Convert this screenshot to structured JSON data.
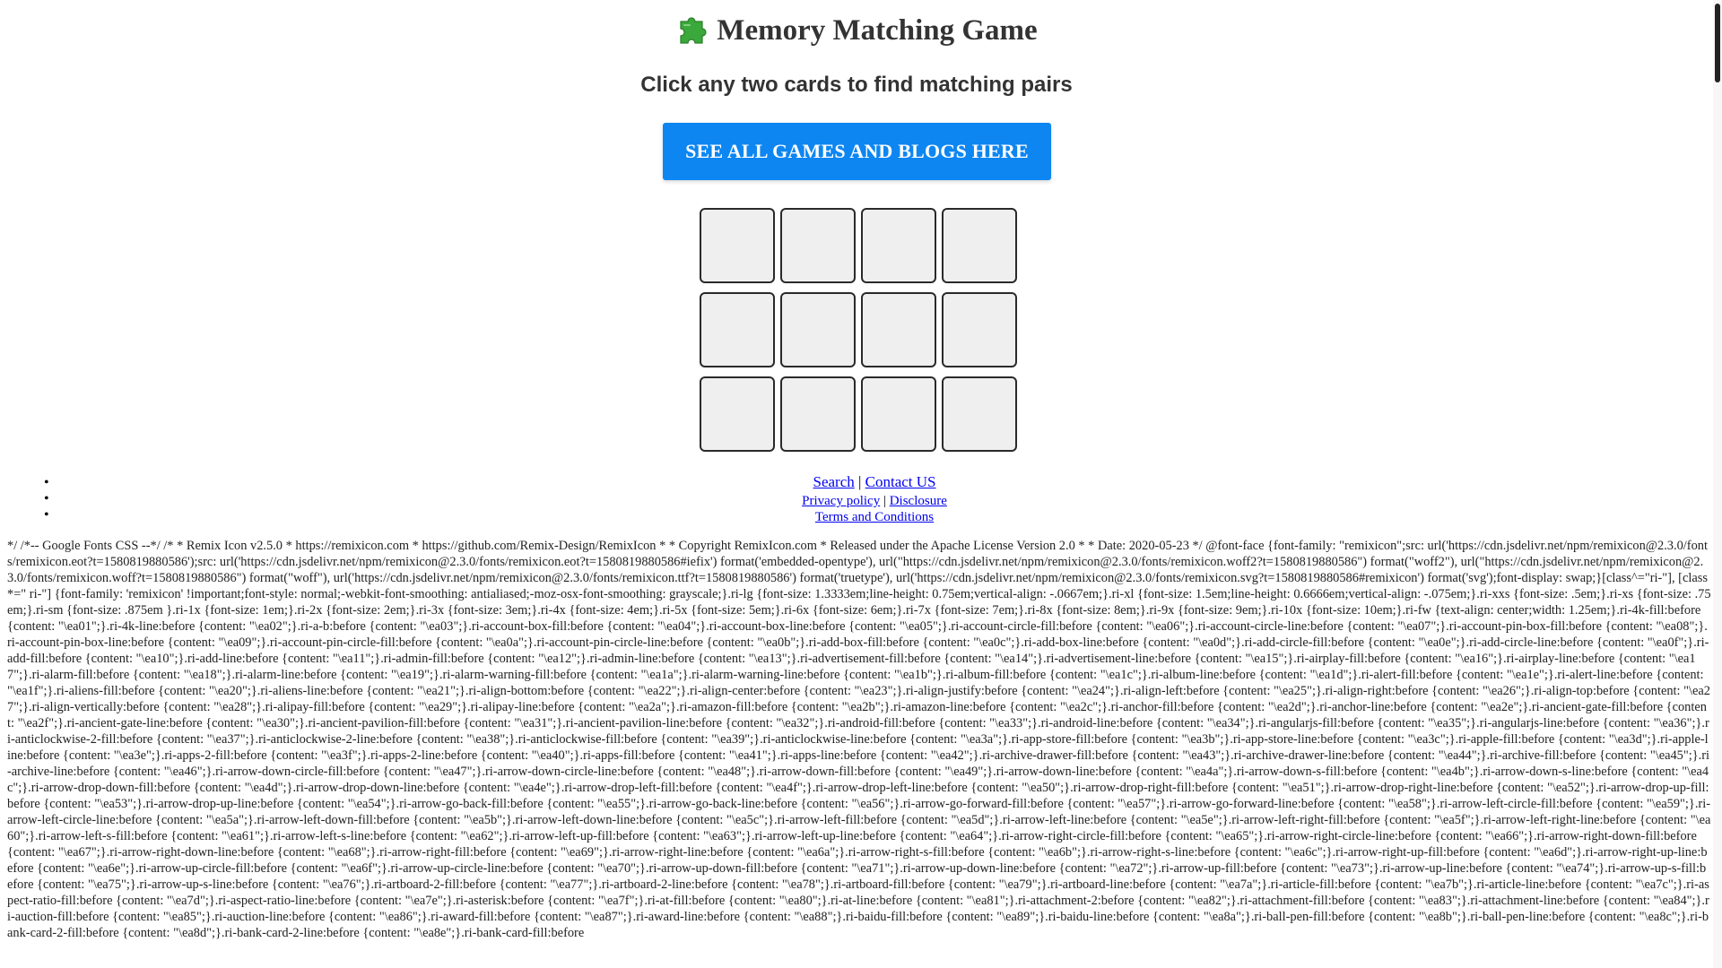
{
  "header": {
    "title": "Memory Matching Game",
    "subtitle": "Click any two cards to find matching pairs",
    "icon": "puzzle-piece-icon"
  },
  "cta": {
    "label": "SEE ALL GAMES AND BLOGS HERE",
    "color": "#0d86f2"
  },
  "board": {
    "rows": 3,
    "columns": 4,
    "card_color": "#efefef",
    "border_color": "#2a2a2a"
  },
  "footer": {
    "search": "Search",
    "separator": "|",
    "contact": "Contact US",
    "privacy": "Privacy policy",
    "disclosure": "Disclosure",
    "terms": "Terms and Conditions"
  },
  "css_dump": "*/ /*-- Google Fonts CSS --*/ /* * Remix Icon v2.5.0 * https://remixicon.com * https://github.com/Remix-Design/RemixIcon * * Copyright RemixIcon.com * Released under the Apache License Version 2.0 * * Date: 2020-05-23 */ @font-face {font-family: \"remixicon\";src: url('https://cdn.jsdelivr.net/npm/remixicon@2.3.0/fonts/remixicon.eot?t=1580819880586');src: url('https://cdn.jsdelivr.net/npm/remixicon@2.3.0/fonts/remixicon.eot?t=1580819880586#iefix') format('embedded-opentype'), url(\"https://cdn.jsdelivr.net/npm/remixicon@2.3.0/fonts/remixicon.woff2?t=1580819880586\") format(\"woff2\"), url(\"https://cdn.jsdelivr.net/npm/remixicon@2.3.0/fonts/remixicon.woff?t=1580819880586\") format(\"woff\"), url('https://cdn.jsdelivr.net/npm/remixicon@2.3.0/fonts/remixicon.ttf?t=1580819880586') format('truetype'), url('https://cdn.jsdelivr.net/npm/remixicon@2.3.0/fonts/remixicon.svg?t=1580819880586#remixicon') format('svg');font-display: swap;}[class^=\"ri-\"], [class*=\" ri-\"] {font-family: 'remixicon' !important;font-style: normal;-webkit-font-smoothing: antialiased;-moz-osx-font-smoothing: grayscale;}.ri-lg {font-size: 1.3333em;line-height: 0.75em;vertical-align: -.0667em;}.ri-xl {font-size: 1.5em;line-height: 0.6666em;vertical-align: -.075em;}.ri-xxs {font-size: .5em;}.ri-xs {font-size: .75em;}.ri-sm {font-size: .875em }.ri-1x {font-size: 1em;}.ri-2x {font-size: 2em;}.ri-3x {font-size: 3em;}.ri-4x {font-size: 4em;}.ri-5x {font-size: 5em;}.ri-6x {font-size: 6em;}.ri-7x {font-size: 7em;}.ri-8x {font-size: 8em;}.ri-9x {font-size: 9em;}.ri-10x {font-size: 10em;}.ri-fw {text-align: center;width: 1.25em;}.ri-4k-fill:before {content: \"\\ea01\";}.ri-4k-line:before {content: \"\\ea02\";}.ri-a-b:before {content: \"\\ea03\";}.ri-account-box-fill:before {content: \"\\ea04\";}.ri-account-box-line:before {content: \"\\ea05\";}.ri-account-circle-fill:before {content: \"\\ea06\";}.ri-account-circle-line:before {content: \"\\ea07\";}.ri-account-pin-box-fill:before {content: \"\\ea08\";}.ri-account-pin-box-line:before {content: \"\\ea09\";}.ri-account-pin-circle-fill:before {content: \"\\ea0a\";}.ri-account-pin-circle-line:before {content: \"\\ea0b\";}.ri-add-box-fill:before {content: \"\\ea0c\";}.ri-add-box-line:before {content: \"\\ea0d\";}.ri-add-circle-fill:before {content: \"\\ea0e\";}.ri-add-circle-line:before {content: \"\\ea0f\";}.ri-add-fill:before {content: \"\\ea10\";}.ri-add-line:before {content: \"\\ea11\";}.ri-admin-fill:before {content: \"\\ea12\";}.ri-admin-line:before {content: \"\\ea13\";}.ri-advertisement-fill:before {content: \"\\ea14\";}.ri-advertisement-line:before {content: \"\\ea15\";}.ri-airplay-fill:before {content: \"\\ea16\";}.ri-airplay-line:before {content: \"\\ea17\";}.ri-alarm-fill:before {content: \"\\ea18\";}.ri-alarm-line:before {content: \"\\ea19\";}.ri-alarm-warning-fill:before {content: \"\\ea1a\";}.ri-alarm-warning-line:before {content: \"\\ea1b\";}.ri-album-fill:before {content: \"\\ea1c\";}.ri-album-line:before {content: \"\\ea1d\";}.ri-alert-fill:before {content: \"\\ea1e\";}.ri-alert-line:before {content: \"\\ea1f\";}.ri-aliens-fill:before {content: \"\\ea20\";}.ri-aliens-line:before {content: \"\\ea21\";}.ri-align-bottom:before {content: \"\\ea22\";}.ri-align-center:before {content: \"\\ea23\";}.ri-align-justify:before {content: \"\\ea24\";}.ri-align-left:before {content: \"\\ea25\";}.ri-align-right:before {content: \"\\ea26\";}.ri-align-top:before {content: \"\\ea27\";}.ri-align-vertically:before {content: \"\\ea28\";}.ri-alipay-fill:before {content: \"\\ea29\";}.ri-alipay-line:before {content: \"\\ea2a\";}.ri-amazon-fill:before {content: \"\\ea2b\";}.ri-amazon-line:before {content: \"\\ea2c\";}.ri-anchor-fill:before {content: \"\\ea2d\";}.ri-anchor-line:before {content: \"\\ea2e\";}.ri-ancient-gate-fill:before {content: \"\\ea2f\";}.ri-ancient-gate-line:before {content: \"\\ea30\";}.ri-ancient-pavilion-fill:before {content: \"\\ea31\";}.ri-ancient-pavilion-line:before {content: \"\\ea32\";}.ri-android-fill:before {content: \"\\ea33\";}.ri-android-line:before {content: \"\\ea34\";}.ri-angularjs-fill:before {content: \"\\ea35\";}.ri-angularjs-line:before {content: \"\\ea36\";}.ri-anticlockwise-2-fill:before {content: \"\\ea37\";}.ri-anticlockwise-2-line:before {content: \"\\ea38\";}.ri-anticlockwise-fill:before {content: \"\\ea39\";}.ri-anticlockwise-line:before {content: \"\\ea3a\";}.ri-app-store-fill:before {content: \"\\ea3b\";}.ri-app-store-line:before {content: \"\\ea3c\";}.ri-apple-fill:before {content: \"\\ea3d\";}.ri-apple-line:before {content: \"\\ea3e\";}.ri-apps-2-fill:before {content: \"\\ea3f\";}.ri-apps-2-line:before {content: \"\\ea40\";}.ri-apps-fill:before {content: \"\\ea41\";}.ri-apps-line:before {content: \"\\ea42\";}.ri-archive-drawer-fill:before {content: \"\\ea43\";}.ri-archive-drawer-line:before {content: \"\\ea44\";}.ri-archive-fill:before {content: \"\\ea45\";}.ri-archive-line:before {content: \"\\ea46\";}.ri-arrow-down-circle-fill:before {content: \"\\ea47\";}.ri-arrow-down-circle-line:before {content: \"\\ea48\";}.ri-arrow-down-fill:before {content: \"\\ea49\";}.ri-arrow-down-line:before {content: \"\\ea4a\";}.ri-arrow-down-s-fill:before {content: \"\\ea4b\";}.ri-arrow-down-s-line:before {content: \"\\ea4c\";}.ri-arrow-drop-down-fill:before {content: \"\\ea4d\";}.ri-arrow-drop-down-line:before {content: \"\\ea4e\";}.ri-arrow-drop-left-fill:before {content: \"\\ea4f\";}.ri-arrow-drop-left-line:before {content: \"\\ea50\";}.ri-arrow-drop-right-fill:before {content: \"\\ea51\";}.ri-arrow-drop-right-line:before {content: \"\\ea52\";}.ri-arrow-drop-up-fill:before {content: \"\\ea53\";}.ri-arrow-drop-up-line:before {content: \"\\ea54\";}.ri-arrow-go-back-fill:before {content: \"\\ea55\";}.ri-arrow-go-back-line:before {content: \"\\ea56\";}.ri-arrow-go-forward-fill:before {content: \"\\ea57\";}.ri-arrow-go-forward-line:before {content: \"\\ea58\";}.ri-arrow-left-circle-fill:before {content: \"\\ea59\";}.ri-arrow-left-circle-line:before {content: \"\\ea5a\";}.ri-arrow-left-down-fill:before {content: \"\\ea5b\";}.ri-arrow-left-down-line:before {content: \"\\ea5c\";}.ri-arrow-left-fill:before {content: \"\\ea5d\";}.ri-arrow-left-line:before {content: \"\\ea5e\";}.ri-arrow-left-right-fill:before {content: \"\\ea5f\";}.ri-arrow-left-right-line:before {content: \"\\ea60\";}.ri-arrow-left-s-fill:before {content: \"\\ea61\";}.ri-arrow-left-s-line:before {content: \"\\ea62\";}.ri-arrow-left-up-fill:before {content: \"\\ea63\";}.ri-arrow-left-up-line:before {content: \"\\ea64\";}.ri-arrow-right-circle-fill:before {content: \"\\ea65\";}.ri-arrow-right-circle-line:before {content: \"\\ea66\";}.ri-arrow-right-down-fill:before {content: \"\\ea67\";}.ri-arrow-right-down-line:before {content: \"\\ea68\";}.ri-arrow-right-fill:before {content: \"\\ea69\";}.ri-arrow-right-line:before {content: \"\\ea6a\";}.ri-arrow-right-s-fill:before {content: \"\\ea6b\";}.ri-arrow-right-s-line:before {content: \"\\ea6c\";}.ri-arrow-right-up-fill:before {content: \"\\ea6d\";}.ri-arrow-right-up-line:before {content: \"\\ea6e\";}.ri-arrow-up-circle-fill:before {content: \"\\ea6f\";}.ri-arrow-up-circle-line:before {content: \"\\ea70\";}.ri-arrow-up-down-fill:before {content: \"\\ea71\";}.ri-arrow-up-down-line:before {content: \"\\ea72\";}.ri-arrow-up-fill:before {content: \"\\ea73\";}.ri-arrow-up-line:before {content: \"\\ea74\";}.ri-arrow-up-s-fill:before {content: \"\\ea75\";}.ri-arrow-up-s-line:before {content: \"\\ea76\";}.ri-artboard-2-fill:before {content: \"\\ea77\";}.ri-artboard-2-line:before {content: \"\\ea78\";}.ri-artboard-fill:before {content: \"\\ea79\";}.ri-artboard-line:before {content: \"\\ea7a\";}.ri-article-fill:before {content: \"\\ea7b\";}.ri-article-line:before {content: \"\\ea7c\";}.ri-aspect-ratio-fill:before {content: \"\\ea7d\";}.ri-aspect-ratio-line:before {content: \"\\ea7e\";}.ri-asterisk:before {content: \"\\ea7f\";}.ri-at-fill:before {content: \"\\ea80\";}.ri-at-line:before {content: \"\\ea81\";}.ri-attachment-2:before {content: \"\\ea82\";}.ri-attachment-fill:before {content: \"\\ea83\";}.ri-attachment-line:before {content: \"\\ea84\";}.ri-auction-fill:before {content: \"\\ea85\";}.ri-auction-line:before {content: \"\\ea86\";}.ri-award-fill:before {content: \"\\ea87\";}.ri-award-line:before {content: \"\\ea88\";}.ri-baidu-fill:before {content: \"\\ea89\";}.ri-baidu-line:before {content: \"\\ea8a\";}.ri-ball-pen-fill:before {content: \"\\ea8b\";}.ri-ball-pen-line:before {content: \"\\ea8c\";}.ri-bank-card-2-fill:before {content: \"\\ea8d\";}.ri-bank-card-2-line:before {content: \"\\ea8e\";}.ri-bank-card-fill:before"
}
